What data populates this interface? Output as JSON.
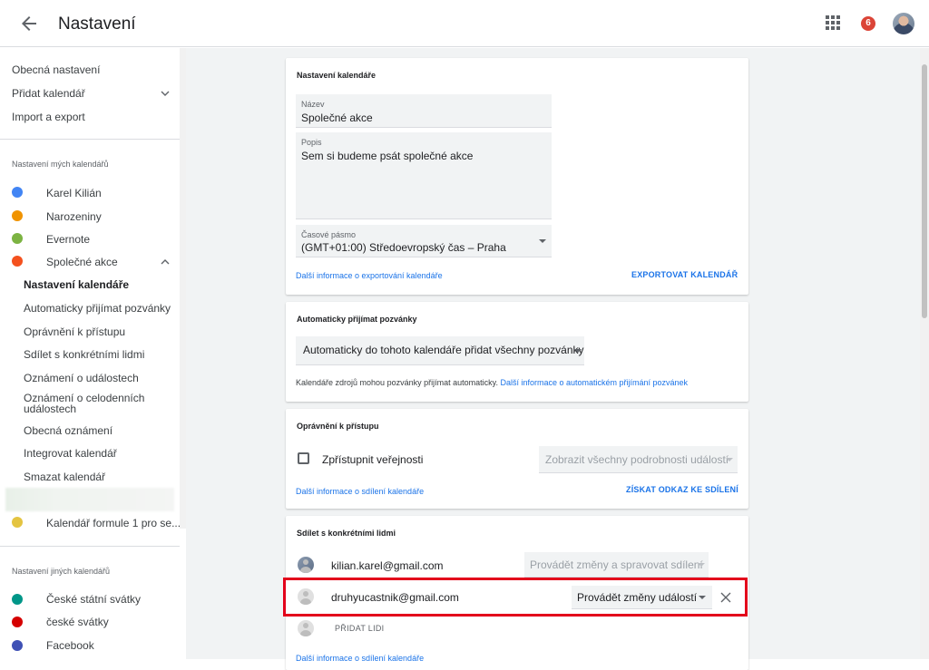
{
  "header": {
    "title": "Nastavení",
    "notification_count": "6"
  },
  "sidebar": {
    "top_items": [
      {
        "label": "Obecná nastavení"
      },
      {
        "label": "Přidat kalendář"
      },
      {
        "label": "Import a export"
      }
    ],
    "my_calendars_heading": "Nastavení mých kalendářů",
    "my_calendars": [
      {
        "label": "Karel Kilián",
        "color": "#4285f4"
      },
      {
        "label": "Narozeniny",
        "color": "#f09300"
      },
      {
        "label": "Evernote",
        "color": "#7cb342"
      },
      {
        "label": "Společné akce",
        "color": "#f4511e"
      }
    ],
    "sub_items": [
      {
        "label": "Nastavení kalendáře"
      },
      {
        "label": "Automaticky přijímat pozvánky"
      },
      {
        "label": "Oprávnění k přístupu"
      },
      {
        "label": "Sdílet s konkrétními lidmi"
      },
      {
        "label": "Oznámení o událostech"
      },
      {
        "label": "Oznámení o celodenních událostech"
      },
      {
        "label": "Obecná oznámení"
      },
      {
        "label": "Integrovat kalendář"
      },
      {
        "label": "Smazat kalendář"
      }
    ],
    "f1_calendar": {
      "label": "Kalendář formule 1 pro se...",
      "color": "#e4c441"
    },
    "other_calendars_heading": "Nastavení jiných kalendářů",
    "other_calendars": [
      {
        "label": "České státní svátky",
        "color": "#009688"
      },
      {
        "label": "české svátky",
        "color": "#d50000"
      },
      {
        "label": "Facebook",
        "color": "#3f51b5"
      }
    ]
  },
  "calendar_settings": {
    "title": "Nastavení kalendáře",
    "name_label": "Název",
    "name_value": "Společné akce",
    "desc_label": "Popis",
    "desc_value": "Sem si budeme psát společné akce",
    "tz_label": "Časové pásmo",
    "tz_value": "(GMT+01:00) Středoevropský čas – Praha",
    "export_info_link": "Další informace o exportování kalendáře",
    "export_button": "EXPORTOVAT KALENDÁŘ"
  },
  "auto_accept": {
    "title": "Automaticky přijímat pozvánky",
    "select_value": "Automaticky do tohoto kalendáře přidat všechny pozvánky",
    "info_text": "Kalendáře zdrojů mohou pozvánky přijímat automaticky.",
    "info_link": "Další informace o automatickém přijímání pozvánek"
  },
  "access": {
    "title": "Oprávnění k přístupu",
    "public_label": "Zpřístupnit veřejnosti",
    "public_select": "Zobrazit všechny podrobnosti událostí",
    "share_info_link": "Další informace o sdílení kalendáře",
    "get_link_button": "ZÍSKAT ODKAZ KE SDÍLENÍ"
  },
  "share": {
    "title": "Sdílet s konkrétními lidmi",
    "people": [
      {
        "email": "kilian.karel@gmail.com",
        "permission": "Provádět změny a spravovat sdílení"
      },
      {
        "email": "druhyucastnik@gmail.com",
        "permission": "Provádět změny událostí"
      }
    ],
    "add_people": "PŘIDAT LIDI",
    "share_info_link": "Další informace o sdílení kalendáře"
  }
}
